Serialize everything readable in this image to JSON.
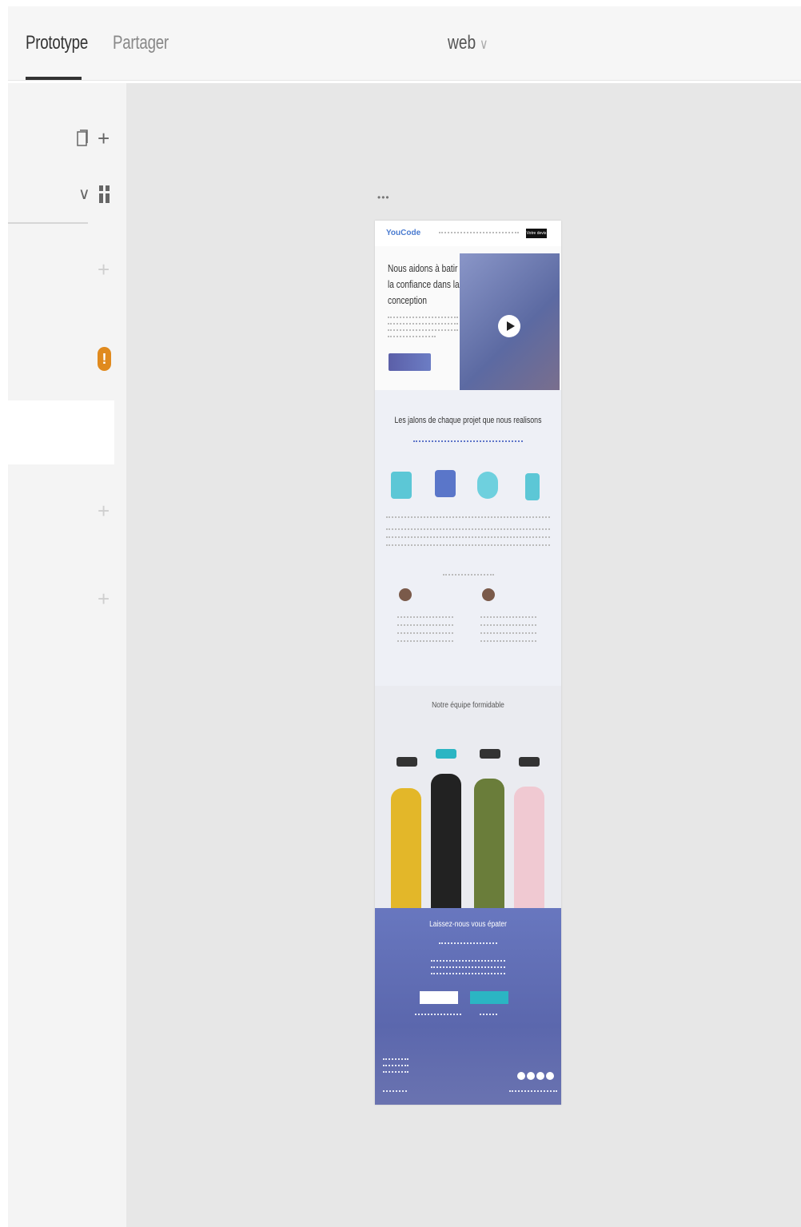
{
  "tabs": {
    "prototype": "Prototype",
    "share": "Partager"
  },
  "view": {
    "current": "web",
    "chevron": "∨"
  },
  "sidebar": {
    "page_icon": "page-icon",
    "add_icon": "plus-icon",
    "collapse_icon": "chevron-down-icon",
    "grid_icon": "grid-icon",
    "warning_icon": "warning-icon",
    "plus_glyph": "+",
    "chevron_glyph": "∨",
    "warning_glyph": "!"
  },
  "artboard": {
    "menu": "•••",
    "nav": {
      "logo": "YouCode",
      "cta": "Votre devis"
    },
    "hero": {
      "title": "Nous aidons à batir la confiance dans la conception"
    },
    "milestones": {
      "title": "Les jalons de chaque projet que nous realisons"
    },
    "team": {
      "title": "Notre équipe formidable"
    },
    "footer": {
      "title": "Laissez-nous vous épater"
    }
  },
  "colors": {
    "accent": "#5b67ad",
    "teal": "#2bb5c3",
    "warning": "#e08a1e"
  }
}
